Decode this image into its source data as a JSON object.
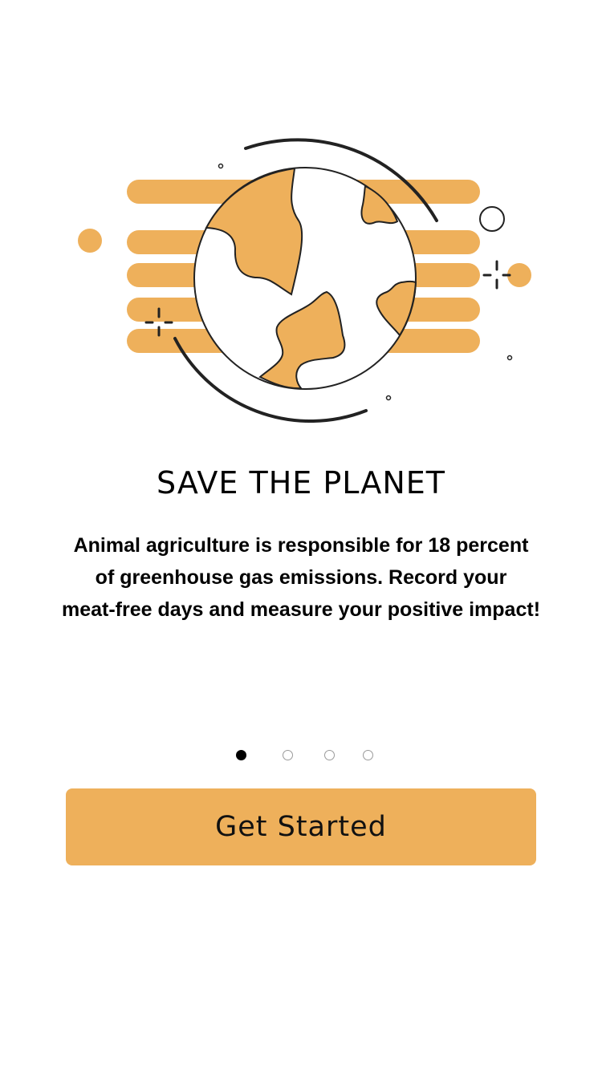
{
  "illustration": {
    "icon": "globe-icon",
    "accent_color": "#EEB05B",
    "stroke_color": "#222222"
  },
  "onboarding": {
    "title": "SAVE THE PLANET",
    "description_lines": [
      "Animal agriculture is responsible for 18 percent",
      "of greenhouse gas emissions. Record your",
      "meat-free days and measure your positive impact!"
    ]
  },
  "pagination": {
    "total_pages": 4,
    "current_page": 1
  },
  "cta": {
    "label": "Get Started",
    "color": "#EEB05B"
  }
}
